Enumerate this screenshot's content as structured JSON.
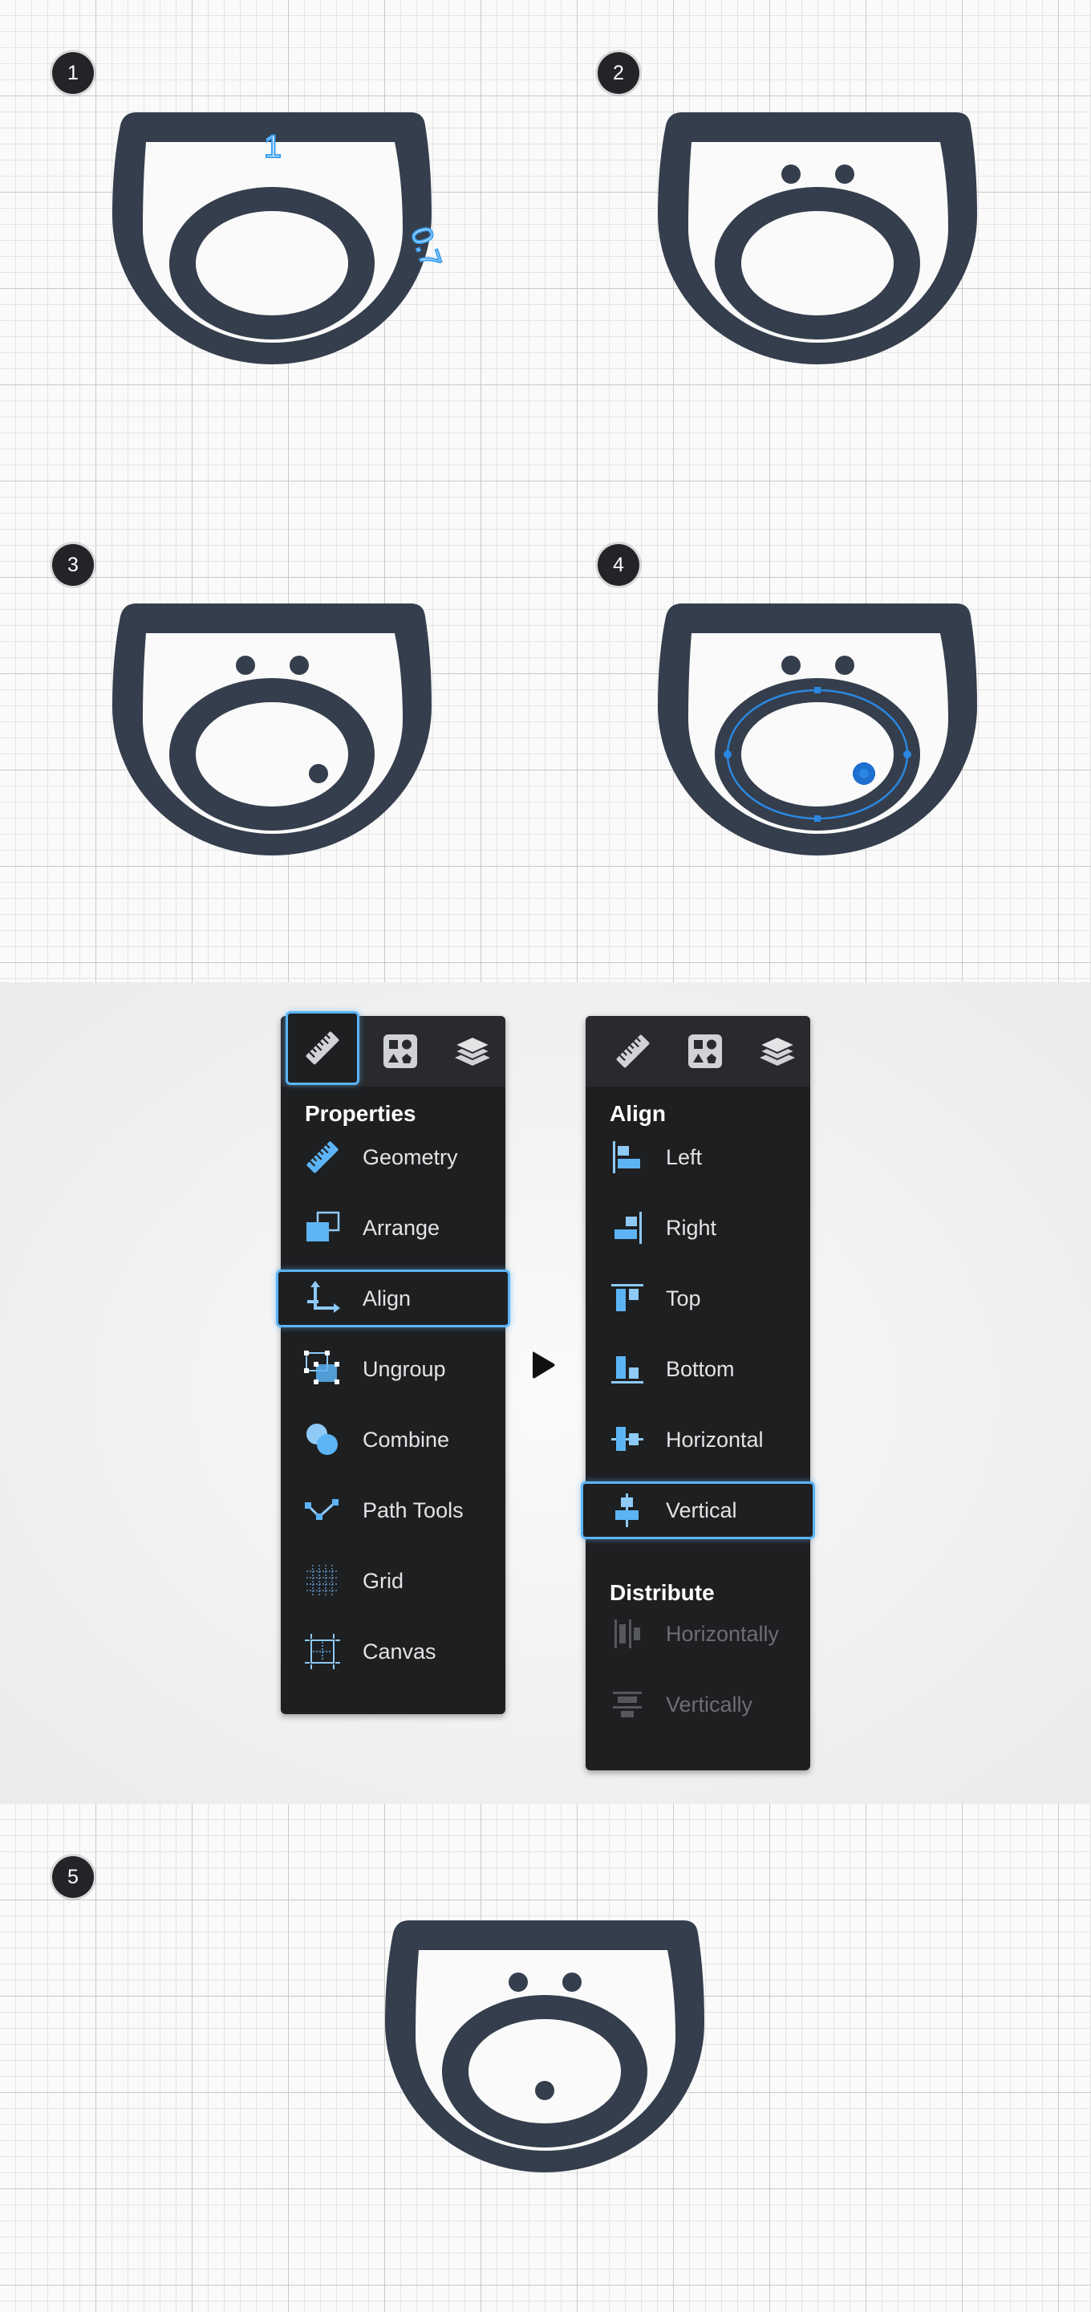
{
  "steps": [
    {
      "number": "1",
      "annotations": {
        "top": "1",
        "side": "0.7"
      }
    },
    {
      "number": "2"
    },
    {
      "number": "3"
    },
    {
      "number": "4"
    },
    {
      "number": "5"
    }
  ],
  "colors": {
    "icon_fill": "#353e4c",
    "selection_blue": "#2b87e0",
    "accent_blue": "#5cb4f5",
    "panel_bg": "#1e1f21",
    "tab_bar_bg": "#292a2d"
  },
  "left_panel": {
    "tabs": [
      {
        "icon": "ruler-icon",
        "selected": true
      },
      {
        "icon": "shapes-icon",
        "selected": false
      },
      {
        "icon": "layers-icon",
        "selected": false
      }
    ],
    "heading": "Properties",
    "items": [
      {
        "label": "Geometry",
        "icon": "ruler-icon"
      },
      {
        "label": "Arrange",
        "icon": "arrange-icon"
      },
      {
        "label": "Align",
        "icon": "align-axes-icon",
        "highlighted": true
      },
      {
        "label": "Ungroup",
        "icon": "ungroup-icon"
      },
      {
        "label": "Combine",
        "icon": "combine-icon"
      },
      {
        "label": "Path Tools",
        "icon": "path-tools-icon"
      },
      {
        "label": "Grid",
        "icon": "grid-icon"
      },
      {
        "label": "Canvas",
        "icon": "canvas-icon"
      }
    ]
  },
  "right_panel": {
    "tabs": [
      {
        "icon": "ruler-icon"
      },
      {
        "icon": "shapes-icon"
      },
      {
        "icon": "layers-icon"
      }
    ],
    "align_heading": "Align",
    "align_items": [
      {
        "label": "Left",
        "icon": "align-left-icon"
      },
      {
        "label": "Right",
        "icon": "align-right-icon"
      },
      {
        "label": "Top",
        "icon": "align-top-icon"
      },
      {
        "label": "Bottom",
        "icon": "align-bottom-icon"
      },
      {
        "label": "Horizontal",
        "icon": "align-horizontal-center-icon"
      },
      {
        "label": "Vertical",
        "icon": "align-vertical-center-icon",
        "highlighted": true
      }
    ],
    "distribute_heading": "Distribute",
    "distribute_items": [
      {
        "label": "Horizontally",
        "icon": "distribute-horizontal-icon",
        "disabled": true
      },
      {
        "label": "Vertically",
        "icon": "distribute-vertical-icon",
        "disabled": true
      }
    ]
  }
}
